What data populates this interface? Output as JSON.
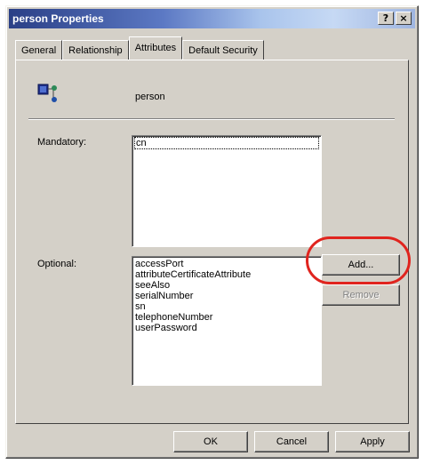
{
  "window": {
    "title": "person Properties",
    "help_glyph": "?",
    "close_glyph": "×"
  },
  "tabs": [
    "General",
    "Relationship",
    "Attributes",
    "Default Security"
  ],
  "active_tab": "Attributes",
  "class": {
    "name": "person",
    "icon": "class-icon"
  },
  "mandatory": {
    "label": "Mandatory:",
    "items": [
      "cn"
    ]
  },
  "optional": {
    "label": "Optional:",
    "items": [
      "accessPort",
      "attributeCertificateAttribute",
      "seeAlso",
      "serialNumber",
      "sn",
      "telephoneNumber",
      "userPassword"
    ]
  },
  "buttons": {
    "add": "Add...",
    "remove": "Remove",
    "ok": "OK",
    "cancel": "Cancel",
    "apply": "Apply"
  },
  "colors": {
    "highlight": "#e0241e",
    "title_start": "#2a3f86"
  }
}
